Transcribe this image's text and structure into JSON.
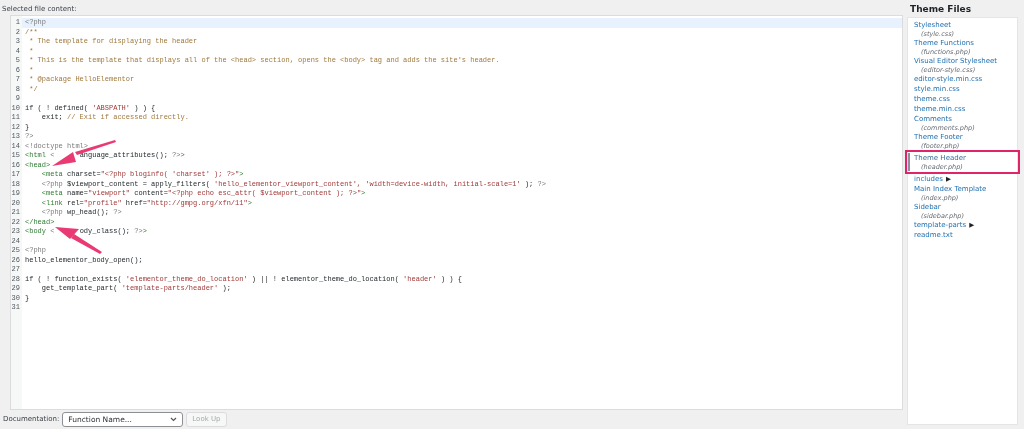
{
  "editor": {
    "label": "Selected file content:",
    "lines": [
      {
        "number": "1",
        "segments": [
          {
            "text": "<?php",
            "kind": "meta"
          }
        ]
      },
      {
        "number": "2",
        "segments": [
          {
            "text": "/**",
            "kind": "comment"
          }
        ]
      },
      {
        "number": "3",
        "segments": [
          {
            "text": " * The template for displaying the header",
            "kind": "comment"
          }
        ]
      },
      {
        "number": "4",
        "segments": [
          {
            "text": " *",
            "kind": "comment"
          }
        ]
      },
      {
        "number": "5",
        "segments": [
          {
            "text": " * This is the template that displays all of the <head> section, opens the <body> tag and adds the site's header.",
            "kind": "comment"
          }
        ]
      },
      {
        "number": "6",
        "segments": [
          {
            "text": " *",
            "kind": "comment"
          }
        ]
      },
      {
        "number": "7",
        "segments": [
          {
            "text": " * @package HelloElementor",
            "kind": "comment"
          }
        ]
      },
      {
        "number": "8",
        "segments": [
          {
            "text": " */",
            "kind": "comment"
          }
        ]
      },
      {
        "number": "9"
      },
      {
        "number": "10",
        "segments": [
          {
            "text": "if ( ! defined( ",
            "kind": "plain"
          },
          {
            "text": "'ABSPATH'",
            "kind": "string"
          },
          {
            "text": " ) ) {",
            "kind": "plain"
          }
        ]
      },
      {
        "number": "11",
        "segments": [
          {
            "text": "    exit; ",
            "kind": "plain"
          },
          {
            "text": "// Exit if accessed directly.",
            "kind": "comment"
          }
        ]
      },
      {
        "number": "12",
        "segments": [
          {
            "text": "}",
            "kind": "plain"
          }
        ]
      },
      {
        "number": "13",
        "segments": [
          {
            "text": "?>",
            "kind": "meta"
          }
        ]
      },
      {
        "number": "14",
        "segments": [
          {
            "text": "<!doctype html>",
            "kind": "meta"
          }
        ]
      },
      {
        "number": "15",
        "segments": [
          {
            "text": "<html ",
            "kind": "tag"
          },
          {
            "text": "<",
            "kind": "meta"
          },
          {
            "text": "      anguage_attributes(); ",
            "kind": "plain"
          },
          {
            "text": "?>",
            "kind": "meta"
          },
          {
            "text": ">",
            "kind": "tag"
          }
        ]
      },
      {
        "number": "16",
        "segments": [
          {
            "text": "<head>",
            "kind": "tag"
          }
        ]
      },
      {
        "number": "17",
        "segments": [
          {
            "text": "    <meta ",
            "kind": "tag"
          },
          {
            "text": "charset=",
            "kind": "plain"
          },
          {
            "text": "\"<?php bloginfo( 'charset' ); ?>\"",
            "kind": "string"
          },
          {
            "text": ">",
            "kind": "tag"
          }
        ]
      },
      {
        "number": "18",
        "segments": [
          {
            "text": "    <?php ",
            "kind": "meta"
          },
          {
            "text": "$viewport_content = apply_filters( ",
            "kind": "plain"
          },
          {
            "text": "'hello_elementor_viewport_content', 'width=device-width, initial-scale=1'",
            "kind": "string"
          },
          {
            "text": " ); ",
            "kind": "plain"
          },
          {
            "text": "?>",
            "kind": "meta"
          }
        ]
      },
      {
        "number": "19",
        "segments": [
          {
            "text": "    <meta ",
            "kind": "tag"
          },
          {
            "text": "name=",
            "kind": "plain"
          },
          {
            "text": "\"viewport\"",
            "kind": "string"
          },
          {
            "text": " content=",
            "kind": "plain"
          },
          {
            "text": "\"<?php echo esc_attr( $viewport_content ); ?>\"",
            "kind": "string"
          },
          {
            "text": ">",
            "kind": "tag"
          }
        ]
      },
      {
        "number": "20",
        "segments": [
          {
            "text": "    <link ",
            "kind": "tag"
          },
          {
            "text": "rel=",
            "kind": "plain"
          },
          {
            "text": "\"profile\"",
            "kind": "string"
          },
          {
            "text": " href=",
            "kind": "plain"
          },
          {
            "text": "\"http://gmpg.org/xfn/11\"",
            "kind": "string"
          },
          {
            "text": ">",
            "kind": "tag"
          }
        ]
      },
      {
        "number": "21",
        "segments": [
          {
            "text": "    <?php ",
            "kind": "meta"
          },
          {
            "text": "wp_head(); ",
            "kind": "plain"
          },
          {
            "text": "?>",
            "kind": "meta"
          }
        ]
      },
      {
        "number": "22",
        "segments": [
          {
            "text": "</head>",
            "kind": "tag"
          }
        ]
      },
      {
        "number": "23",
        "segments": [
          {
            "text": "<body ",
            "kind": "tag"
          },
          {
            "text": "<",
            "kind": "meta"
          },
          {
            "text": "      ody_class(); ",
            "kind": "plain"
          },
          {
            "text": "?>",
            "kind": "meta"
          },
          {
            "text": ">",
            "kind": "tag"
          }
        ]
      },
      {
        "number": "24"
      },
      {
        "number": "25",
        "segments": [
          {
            "text": "<?php",
            "kind": "meta"
          }
        ]
      },
      {
        "number": "26",
        "segments": [
          {
            "text": "hello_elementor_body_open();",
            "kind": "plain"
          }
        ]
      },
      {
        "number": "27"
      },
      {
        "number": "28",
        "segments": [
          {
            "text": "if ( ! function_exists( ",
            "kind": "plain"
          },
          {
            "text": "'elementor_theme_do_location'",
            "kind": "string"
          },
          {
            "text": " ) || ! elementor_theme_do_location( ",
            "kind": "plain"
          },
          {
            "text": "'header'",
            "kind": "string"
          },
          {
            "text": " ) ) {",
            "kind": "plain"
          }
        ]
      },
      {
        "number": "29",
        "segments": [
          {
            "text": "    get_template_part( ",
            "kind": "plain"
          },
          {
            "text": "'template-parts/header'",
            "kind": "string"
          },
          {
            "text": " );",
            "kind": "plain"
          }
        ]
      },
      {
        "number": "30",
        "segments": [
          {
            "text": "}",
            "kind": "plain"
          }
        ]
      },
      {
        "number": "31"
      }
    ]
  },
  "sidebar": {
    "title": "Theme Files",
    "items": [
      {
        "kind": "file",
        "label": "Stylesheet",
        "file": "(style.css)",
        "selected": false
      },
      {
        "kind": "file",
        "label": "Theme Functions",
        "file": "(functions.php)",
        "selected": false
      },
      {
        "kind": "file",
        "label": "Visual Editor Stylesheet",
        "file": "(editor-style.css)",
        "selected": false
      },
      {
        "kind": "file",
        "label": "editor-style.min.css",
        "selected": false
      },
      {
        "kind": "file",
        "label": "style.min.css",
        "selected": false
      },
      {
        "kind": "file",
        "label": "theme.css",
        "selected": false
      },
      {
        "kind": "file",
        "label": "theme.min.css",
        "selected": false
      },
      {
        "kind": "file",
        "label": "Comments",
        "file": "(comments.php)",
        "selected": false
      },
      {
        "kind": "file",
        "label": "Theme Footer",
        "file": "(footer.php)",
        "selected": false
      },
      {
        "kind": "file",
        "label": "Theme Header",
        "file": "(header.php)",
        "selected": true
      },
      {
        "kind": "folder",
        "label": "includes",
        "marker": "▶",
        "selected": false
      },
      {
        "kind": "file",
        "label": "Main Index Template",
        "file": "(index.php)",
        "selected": false
      },
      {
        "kind": "file",
        "label": "Sidebar",
        "file": "(sidebar.php)",
        "selected": false
      },
      {
        "kind": "folder",
        "label": "template-parts",
        "marker": "▶",
        "selected": false
      },
      {
        "kind": "file",
        "label": "readme.txt",
        "selected": false
      }
    ]
  },
  "documentation": {
    "label": "Documentation:",
    "select": {
      "placeholder": "Function Name..."
    },
    "button": {
      "label": "Look Up",
      "disabled": true
    }
  }
}
